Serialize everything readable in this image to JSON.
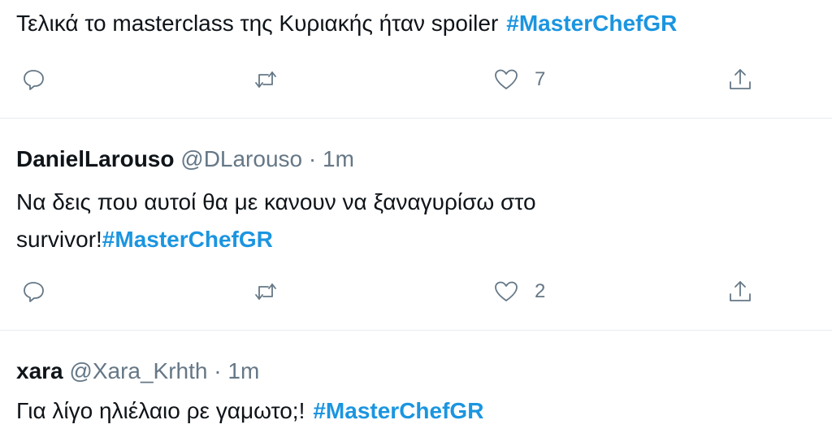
{
  "tweets": [
    {
      "text": "Τελικά το masterclass της Κυριακής ήταν spoiler",
      "hashtag": "#MasterChefGR",
      "actions": {
        "reply_icon": "reply-icon",
        "retweet_icon": "retweet-icon",
        "like_icon": "heart-icon",
        "like_count": "7",
        "share_icon": "share-icon"
      }
    },
    {
      "name": "DanielLarouso",
      "handle": "@DLarouso",
      "time": "· 1m",
      "text_line1": "Να δεις που αυτοί θα με κανουν να ξαναγυρίσω στο",
      "text_line2": "survivor!",
      "hashtag": "#MasterChefGR",
      "actions": {
        "reply_icon": "reply-icon",
        "retweet_icon": "retweet-icon",
        "like_icon": "heart-icon",
        "like_count": "2",
        "share_icon": "share-icon"
      }
    },
    {
      "name": "xara",
      "handle": "@Xara_Krhth",
      "time": "· 1m",
      "text": "Για λίγο ηλιέλαιο ρε γαμωτο;!",
      "hashtag": "#MasterChefGR"
    }
  ],
  "colors": {
    "hashtag": "#1b95e0",
    "meta": "#657786",
    "divider": "#e6ecf0",
    "text": "#0f1419"
  }
}
